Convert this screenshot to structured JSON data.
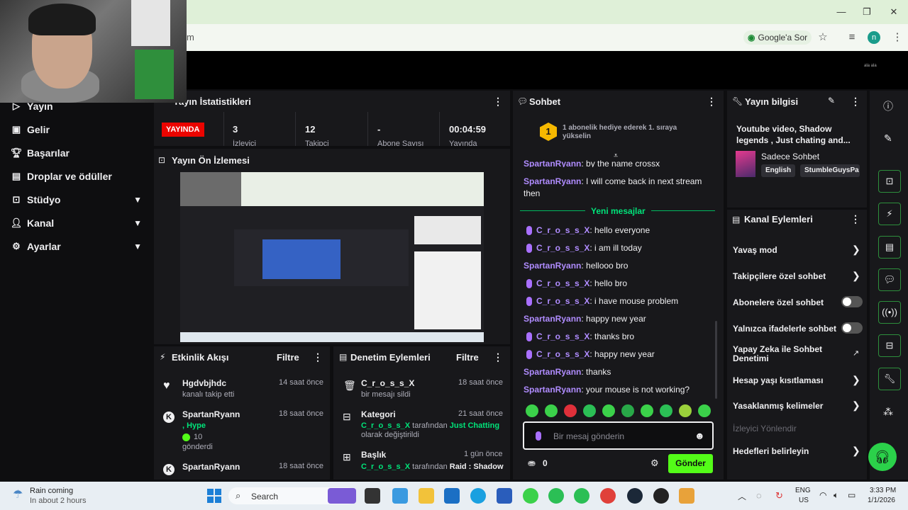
{
  "browser": {
    "url_fragment": "m",
    "google_sor": "Google'a Sor",
    "profile_initial": "n"
  },
  "page_logo": "ala ala",
  "nav": [
    {
      "label": "Yayın",
      "icon": "play-icon"
    },
    {
      "label": "Gelir",
      "icon": "revenue-icon"
    },
    {
      "label": "Başarılar",
      "icon": "trophy-icon"
    },
    {
      "label": "Droplar ve ödüller",
      "icon": "gift-icon"
    },
    {
      "label": "Stüdyo",
      "icon": "studio-icon"
    },
    {
      "label": "Kanal",
      "icon": "user-icon"
    },
    {
      "label": "Ayarlar",
      "icon": "gear-icon"
    }
  ],
  "stats": {
    "title": "Yayın İstatistikleri",
    "live": "YAYINDA",
    "viewers": "3",
    "viewers_label": "İzleyici",
    "followers": "12",
    "followers_label": "Takipçi",
    "subs": "-",
    "subs_label": "Abone Sayısı",
    "time": "00:04:59",
    "time_label": "Yayında"
  },
  "preview": {
    "title": "Yayın Ön İzlemesi"
  },
  "activity": {
    "title": "Etkinlik Akışı",
    "filter": "Filtre",
    "items": [
      {
        "name": "Hgdvbjhdc",
        "sub": "kanalı takip etti",
        "time": "14 saat önce"
      },
      {
        "name": "SpartanRyann",
        "sub1": ", Hype",
        "sub2": "10",
        "sub3": "gönderdi",
        "time": "18 saat önce"
      },
      {
        "name": "SpartanRyann",
        "time": "18 saat önce"
      }
    ]
  },
  "moderation": {
    "title": "Denetim Eylemleri",
    "filter": "Filtre",
    "items": [
      {
        "name": "C_r_o_s_s_X",
        "sub": "bir mesajı sildi",
        "time": "18 saat önce"
      },
      {
        "name": "Kategori",
        "actor": "C_r_o_s_s_X",
        "mid": " tarafından ",
        "value": "Just Chatting",
        "sub": "olarak değiştirildi",
        "time": "21 saat önce"
      },
      {
        "name": "Başlık",
        "actor": "C_r_o_s_s_X",
        "mid": " tarafından ",
        "value": "Raid : Shadow",
        "time": "1 gün önce"
      }
    ]
  },
  "chat": {
    "title": "Sohbet",
    "gift_rank": "1",
    "gift_text": "1 abonelik hediye ederek 1. sıraya yükselin",
    "new_messages": "Yeni mesajlar",
    "messages": [
      {
        "user": "SpartanRyann",
        "text": ": by the name crossx"
      },
      {
        "user": "SpartanRyann",
        "text": ": I will come back in next stream"
      },
      {
        "user": "",
        "text": "then"
      },
      {
        "user": "C_r_o_s_s_X",
        "text": ": hello everyone"
      },
      {
        "user": "C_r_o_s_s_X",
        "text": ": i am ill today"
      },
      {
        "user": "SpartanRyann",
        "text": ": hellooo bro"
      },
      {
        "user": "C_r_o_s_s_X",
        "text": ": hello bro"
      },
      {
        "user": "C_r_o_s_s_X",
        "text": ": i have mouse problem"
      },
      {
        "user": "SpartanRyann",
        "text": ": happy new year"
      },
      {
        "user": "C_r_o_s_s_X",
        "text": ": thanks bro"
      },
      {
        "user": "C_r_o_s_s_X",
        "text": ": happy new year"
      },
      {
        "user": "SpartanRyann",
        "text": ": thanks"
      },
      {
        "user": "SpartanRyann",
        "text": ": your mouse is not working?"
      }
    ],
    "input_placeholder": "Bir mesaj gönderin",
    "points": "0",
    "send": "Gönder"
  },
  "stream_info": {
    "title": "Yayın bilgisi",
    "stream_title": "Youtube video, Shadow legends , Just chating and...",
    "category": "Sadece Sohbet",
    "tags": [
      "English",
      "StumbleGuysPa"
    ]
  },
  "channel_actions": {
    "title": "Kanal Eylemleri",
    "items": [
      {
        "label": "Yavaş mod",
        "control": "chevron"
      },
      {
        "label": "Takipçilere özel sohbet",
        "control": "chevron"
      },
      {
        "label": "Abonelere özel sohbet",
        "control": "toggle"
      },
      {
        "label": "Yalnızca ifadelerle sohbet",
        "control": "toggle"
      },
      {
        "label": "Yapay Zeka ile Sohbet Denetimi",
        "control": "external"
      },
      {
        "label": "Hesap yaşı kısıtlaması",
        "control": "chevron"
      },
      {
        "label": "Yasaklanmış kelimeler",
        "control": "chevron"
      },
      {
        "label": "İzleyici Yönlendir",
        "control": "none"
      },
      {
        "label": "Hedefleri belirleyin",
        "control": "chevron"
      }
    ]
  },
  "taskbar": {
    "weather_title": "Rain coming",
    "weather_sub": "In about 2 hours",
    "search": "Search",
    "lang": "ENG",
    "region": "US",
    "time": "3:33 PM",
    "date": "1/1/2026"
  }
}
